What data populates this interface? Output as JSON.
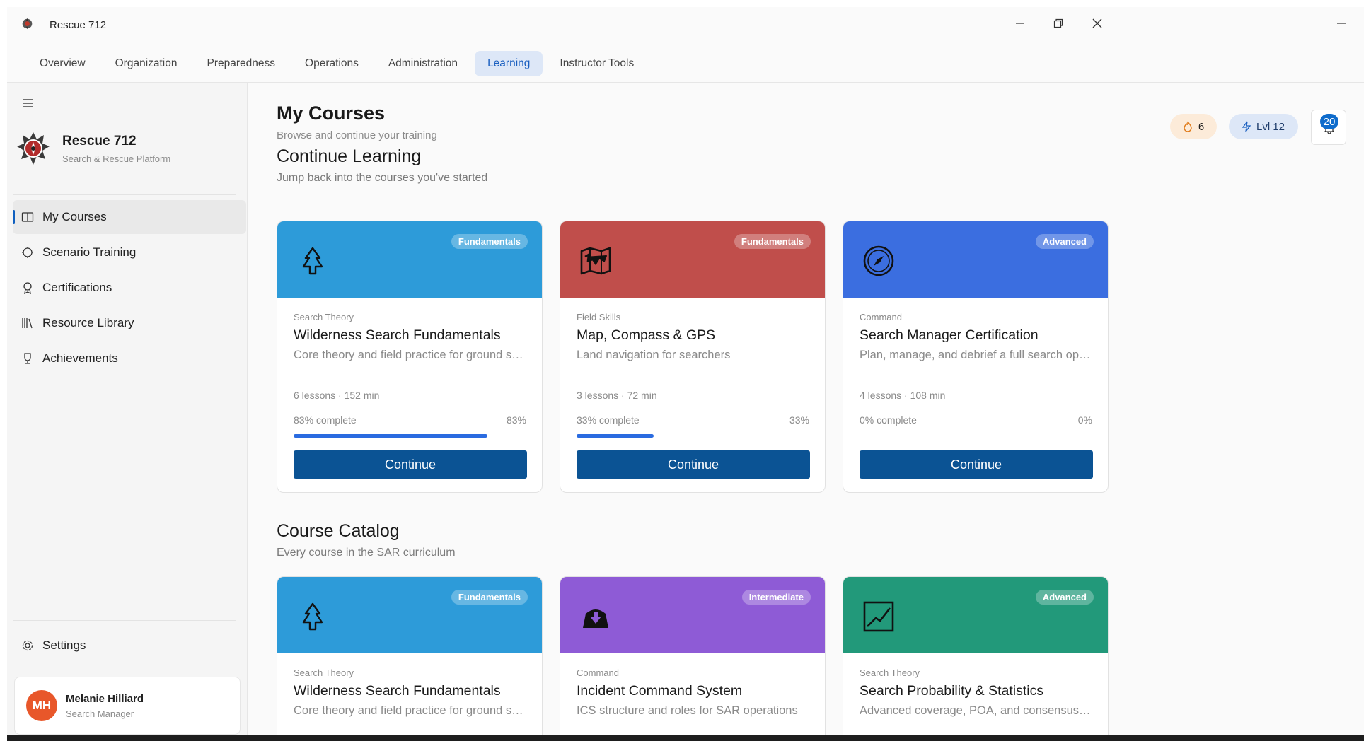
{
  "window": {
    "title": "Rescue 712"
  },
  "tabs": [
    {
      "label": "Overview"
    },
    {
      "label": "Organization"
    },
    {
      "label": "Preparedness"
    },
    {
      "label": "Operations"
    },
    {
      "label": "Administration"
    },
    {
      "label": "Learning",
      "active": true
    },
    {
      "label": "Instructor Tools"
    }
  ],
  "sidebar": {
    "brand": {
      "name": "Rescue 712",
      "subtitle": "Search & Rescue Platform"
    },
    "items": [
      {
        "label": "My Courses",
        "icon": "book-icon",
        "active": true
      },
      {
        "label": "Scenario Training",
        "icon": "scenario-icon"
      },
      {
        "label": "Certifications",
        "icon": "ribbon-icon"
      },
      {
        "label": "Resource Library",
        "icon": "library-icon"
      },
      {
        "label": "Achievements",
        "icon": "trophy-icon"
      }
    ],
    "settings_label": "Settings",
    "user": {
      "initials": "MH",
      "name": "Melanie Hilliard",
      "role": "Search Manager",
      "avatar_color": "#e8572a"
    }
  },
  "header": {
    "title": "My Courses",
    "subtitle": "Browse and continue your training",
    "streak": "6",
    "level": "Lvl 12",
    "notifications": "20"
  },
  "continue_section": {
    "title": "Continue Learning",
    "subtitle": "Jump back into the courses you've started",
    "cards": [
      {
        "color": "#2d9bd9",
        "icon": "tree-icon",
        "badge": "Fundamentals",
        "category": "Search Theory",
        "name": "Wilderness Search Fundamentals",
        "description": "Core theory and field practice for ground search teams",
        "meta": "6 lessons · 152 min",
        "progress_label": "83% complete",
        "progress_pct": "83%",
        "progress": 83,
        "button": "Continue"
      },
      {
        "color": "#c04e4b",
        "icon": "map-icon",
        "badge": "Fundamentals",
        "category": "Field Skills",
        "name": "Map, Compass & GPS",
        "description": "Land navigation for searchers",
        "meta": "3 lessons · 72 min",
        "progress_label": "33% complete",
        "progress_pct": "33%",
        "progress": 33,
        "button": "Continue"
      },
      {
        "color": "#3b6ee0",
        "icon": "compass-icon",
        "badge": "Advanced",
        "category": "Command",
        "name": "Search Manager Certification",
        "description": "Plan, manage, and debrief a full search operation",
        "meta": "4 lessons · 108 min",
        "progress_label": "0% complete",
        "progress_pct": "0%",
        "progress": 0,
        "button": "Continue"
      }
    ]
  },
  "catalog_section": {
    "title": "Course Catalog",
    "subtitle": "Every course in the SAR curriculum",
    "cards": [
      {
        "color": "#2d9bd9",
        "icon": "tree-icon",
        "badge": "Fundamentals",
        "category": "Search Theory",
        "name": "Wilderness Search Fundamentals",
        "description": "Core theory and field practice for ground search teams"
      },
      {
        "color": "#8e5bd6",
        "icon": "command-post-icon",
        "badge": "Intermediate",
        "category": "Command",
        "name": "Incident Command System",
        "description": "ICS structure and roles for SAR operations"
      },
      {
        "color": "#22997a",
        "icon": "chart-icon",
        "badge": "Advanced",
        "category": "Search Theory",
        "name": "Search Probability & Statistics",
        "description": "Advanced coverage, POA, and consensus methods"
      }
    ]
  }
}
